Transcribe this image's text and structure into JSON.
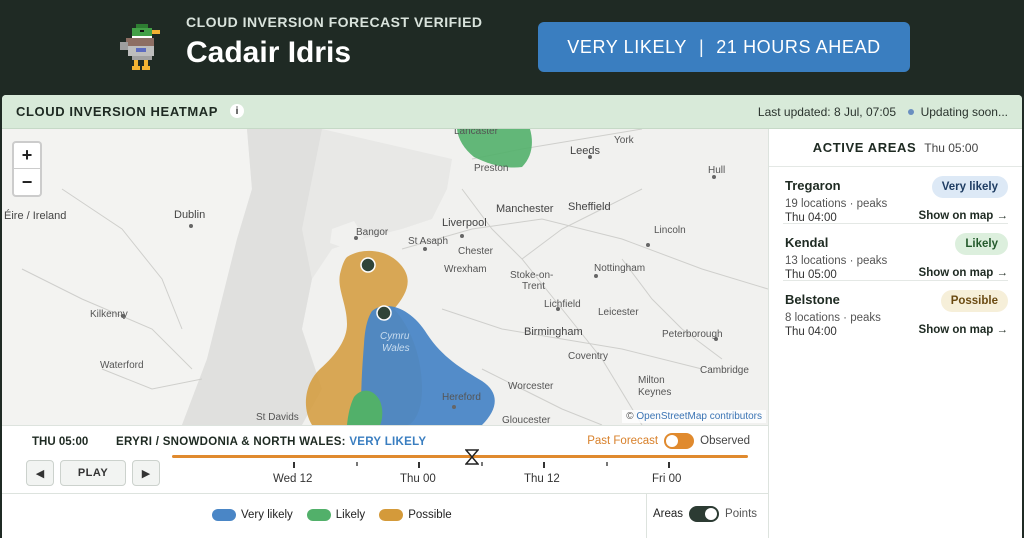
{
  "header": {
    "eyebrow": "CLOUD INVERSION FORECAST VERIFIED",
    "place": "Cadair Idris",
    "pill_left": "VERY LIKELY",
    "pill_sep": "|",
    "pill_right": "21 HOURS AHEAD",
    "logo_icon": "duck-icon"
  },
  "card": {
    "title": "CLOUD INVERSION HEATMAP",
    "info_icon": "i",
    "last_updated": "Last updated: 8 Jul, 07:05",
    "updating": "Updating soon..."
  },
  "map": {
    "zoom_in": "+",
    "zoom_out": "−",
    "attribution_symbol": "©",
    "attribution": "OpenStreetMap contributors",
    "labels": {
      "eire": "Éire / Ireland",
      "dublin": "Dublin",
      "kilkenny": "Kilkenny",
      "waterford": "Waterford",
      "st_davids": "St Davids",
      "bangor": "Bangor",
      "st_asaph": "St Asaph",
      "liverpool": "Liverpool",
      "wrexham": "Wrexham",
      "chester": "Chester",
      "stoke": "Stoke-on-",
      "trent": "Trent",
      "lancaster": "Lancaster",
      "preston": "Preston",
      "leeds": "Leeds",
      "york": "York",
      "hull": "Hull",
      "manchester": "Manchester",
      "sheffield": "Sheffield",
      "lincoln": "Lincoln",
      "nottingham": "Nottingham",
      "lichfield": "Lichfield",
      "leicester": "Leicester",
      "birmingham": "Birmingham",
      "peterborough": "Peterborough",
      "coventry": "Coventry",
      "cambridge": "Cambridge",
      "milton": "Milton",
      "keynes": "Keynes",
      "worcester": "Worcester",
      "hereford": "Hereford",
      "gloucester": "Gloucester",
      "cymru": "Cymru",
      "wales": "Wales"
    }
  },
  "side": {
    "title": "ACTIVE AREAS",
    "time": "Thu 05:00",
    "areas": [
      {
        "name": "Tregaron",
        "meta": "19 locations · peaks",
        "when": "Thu 04:00",
        "badge": "Very likely",
        "show": "Show on map →"
      },
      {
        "name": "Kendal",
        "meta": "13 locations · peaks",
        "when": "Thu 05:00",
        "badge": "Likely",
        "show": "Show on map →"
      },
      {
        "name": "Belstone",
        "meta": "8 locations · peaks",
        "when": "Thu 04:00",
        "badge": "Possible",
        "show": "Show on map →"
      }
    ]
  },
  "timeline": {
    "time": "THU 05:00",
    "region": "ERYRI / SNOWDONIA & NORTH WALES:",
    "region_value": "VERY LIKELY",
    "past_forecast": "Past Forecast",
    "observed": "Observed",
    "prev": "◀",
    "play": "PLAY",
    "next": "▶",
    "ticks": [
      "Wed 12",
      "Thu 00",
      "Thu 12",
      "Fri 00"
    ],
    "position": 0.5
  },
  "legend": {
    "very_likely": "Very likely",
    "likely": "Likely",
    "possible": "Possible",
    "areas": "Areas",
    "points": "Points"
  },
  "colors": {
    "very_likely": "#4a86c6",
    "likely": "#52b06a",
    "possible": "#d49a3a",
    "accent": "#e08a2e",
    "header_bg": "#1f2a24"
  }
}
